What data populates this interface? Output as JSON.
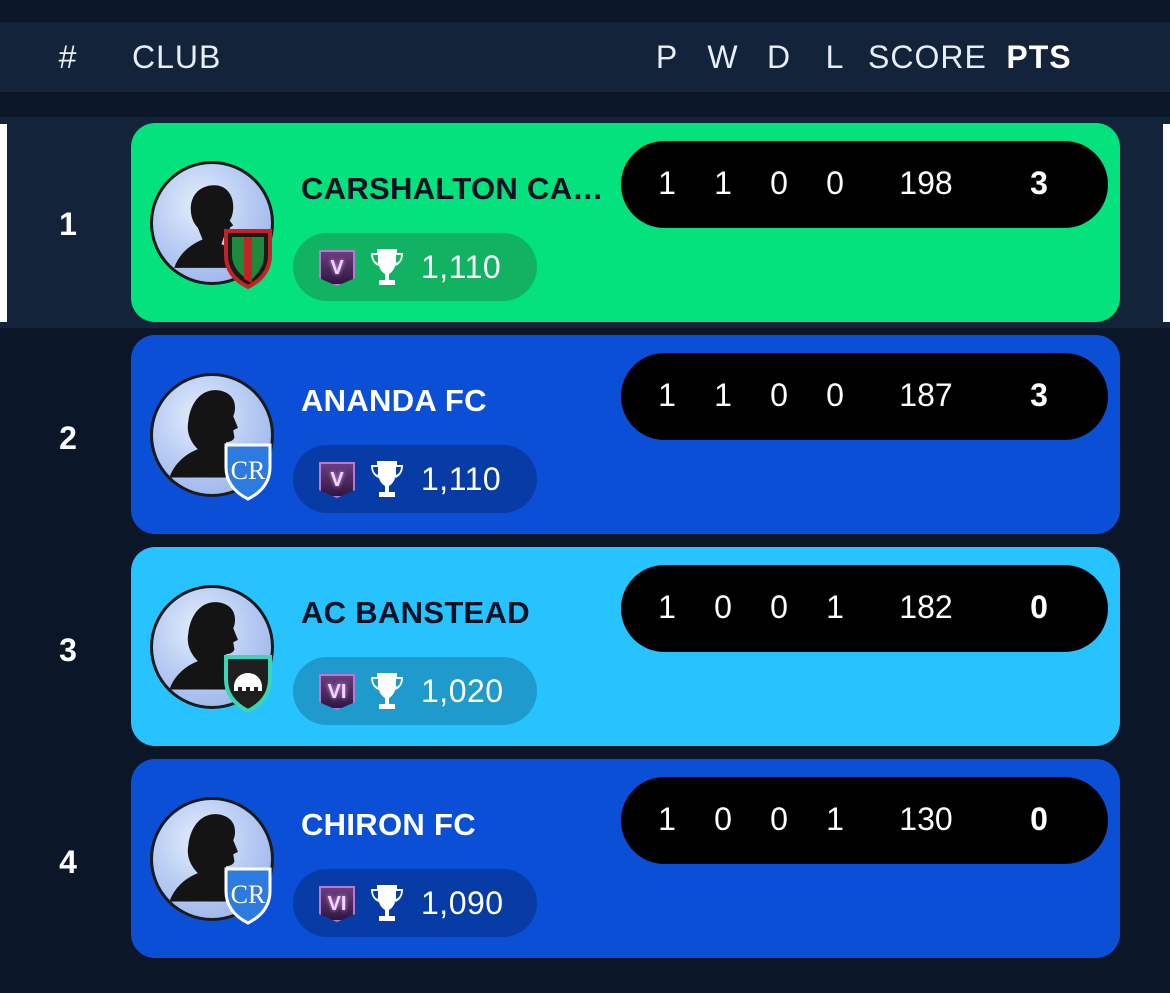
{
  "header": {
    "rank": "#",
    "club": "CLUB",
    "p": "P",
    "w": "W",
    "d": "D",
    "l": "L",
    "score": "SCORE",
    "pts": "PTS"
  },
  "colors": {
    "background": "#0b1728",
    "header_bg": "#13233a",
    "leader_card": "#03e27c",
    "blue_card": "#0a4fd6",
    "light_blue_card": "#26c3ff",
    "stats_pill": "#000000"
  },
  "rows": [
    {
      "rank": "1",
      "club": "CARSHALTON CAS...",
      "tier": "V",
      "trophies": "1,110",
      "p": "1",
      "w": "1",
      "d": "0",
      "l": "0",
      "score": "198",
      "pts": "3",
      "crest_icon": "red-green-shield-icon"
    },
    {
      "rank": "2",
      "club": "ANANDA FC",
      "tier": "V",
      "trophies": "1,110",
      "p": "1",
      "w": "1",
      "d": "0",
      "l": "0",
      "score": "187",
      "pts": "3",
      "crest_icon": "blue-cr-shield-icon"
    },
    {
      "rank": "3",
      "club": "AC BANSTEAD",
      "tier": "VI",
      "trophies": "1,020",
      "p": "1",
      "w": "0",
      "d": "0",
      "l": "1",
      "score": "182",
      "pts": "0",
      "crest_icon": "teal-elephant-shield-icon"
    },
    {
      "rank": "4",
      "club": "CHIRON FC",
      "tier": "VI",
      "trophies": "1,090",
      "p": "1",
      "w": "0",
      "d": "0",
      "l": "1",
      "score": "130",
      "pts": "0",
      "crest_icon": "blue-cr-shield-icon"
    }
  ]
}
